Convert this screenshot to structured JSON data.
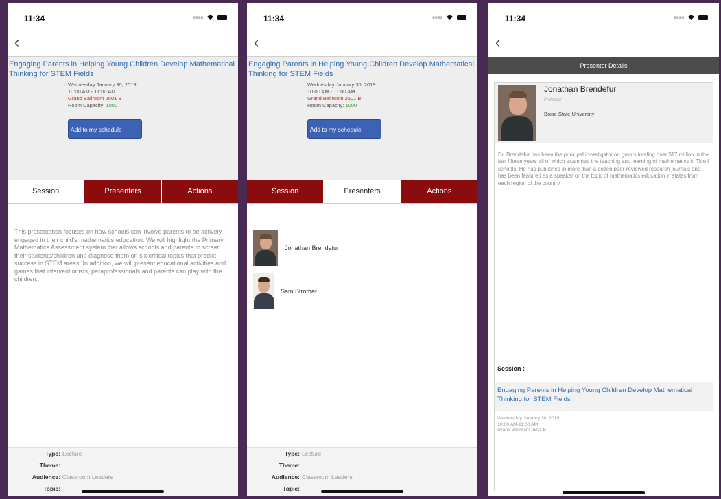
{
  "status": {
    "time": "11:34"
  },
  "session": {
    "title": "Engaging Parents in Helping Young Children Develop Mathematical Thinking for STEM Fields",
    "date": "Wednesday January 30, 2019",
    "time": "10:00 AM  -  11:00 AM",
    "room": "Grand Ballroom 2501 B",
    "capacity_label": "Room Capacity:",
    "capacity_value": "1000",
    "add_button": "Add to my schedule"
  },
  "tabs": [
    "Session",
    "Presenters",
    "Actions"
  ],
  "description": "This presentation focuses on how schools can involve parents to be actively engaged in their child's mathematics education. We will highlight the Primary Mathematics Assessment system that allows schools and parents to screen their students/children and diagnose them on six critical topics that predict success in STEM areas. In addition, we will present educational activities and games that interventionists, paraprofessionals and parents can play with the children.",
  "footer": {
    "type_label": "Type:",
    "type_value": "Lecture",
    "theme_label": "Theme:",
    "theme_value": "",
    "audience_label": "Audience:",
    "audience_value": "Classroom Leaders",
    "topic_label": "Topic:"
  },
  "presenters": [
    {
      "name": "Jonathan Brendefur"
    },
    {
      "name": "Sam Strother"
    }
  ],
  "presenter_details": {
    "bar_title": "Presenter Details",
    "name": "Jonathan Brendefur",
    "role": "Professor",
    "org": "Boise State University",
    "bio": "Dr. Brendefur has been the principal investigator on grants totaling over $17 million in the last fifteen years all of which examined the teaching and learning of mathematics in Title I schools. He has published in more than a dozen peer-reviewed research journals and has been featured as a speaker on the topic of mathematics education in states from each region of the country.",
    "session_label": "Session :",
    "session_title": "Engaging Parents in Helping Young Children Develop Mathematical Thinking for STEM Fields",
    "session_date": "Wednesday January 30, 2019",
    "session_time": "10:00 AM-11:00 AM",
    "session_room": "Grand Ballroom 2501 B"
  }
}
